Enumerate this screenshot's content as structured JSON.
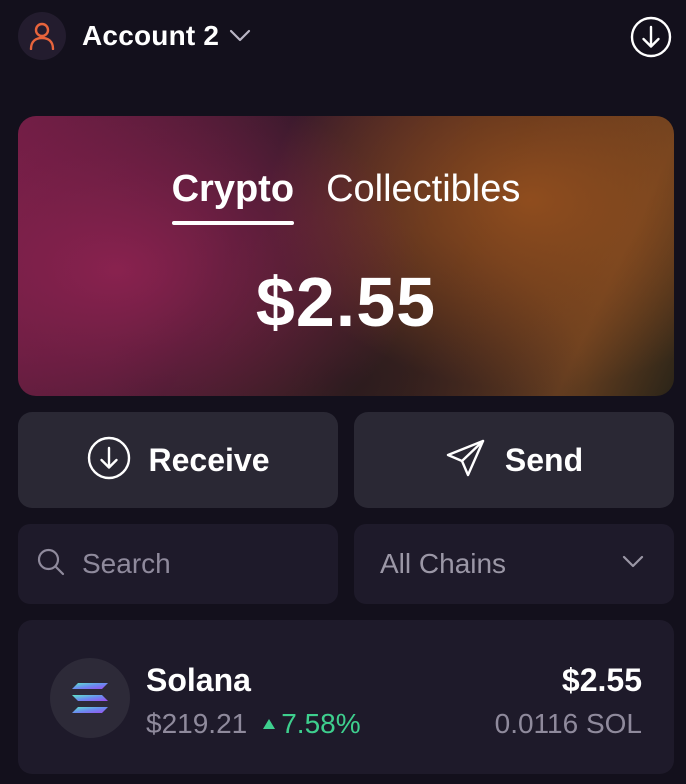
{
  "header": {
    "account_name": "Account 2",
    "avatar_icon": "person-icon",
    "chevron_icon": "chevron-down-icon",
    "download_icon": "arrow-down-circle-icon"
  },
  "balance_card": {
    "tabs": [
      {
        "label": "Crypto",
        "active": true
      },
      {
        "label": "Collectibles",
        "active": false
      }
    ],
    "total_balance": "$2.55"
  },
  "actions": {
    "receive_label": "Receive",
    "receive_icon": "arrow-down-circle-icon",
    "send_label": "Send",
    "send_icon": "paper-plane-icon"
  },
  "filters": {
    "search_placeholder": "Search",
    "search_value": "",
    "search_icon": "search-icon",
    "chain_selected": "All Chains",
    "chain_icon": "chevron-down-icon"
  },
  "tokens": [
    {
      "name": "Solana",
      "icon": "solana-logo-icon",
      "price": "$219.21",
      "change": "7.58%",
      "change_direction": "up",
      "value": "$2.55",
      "quantity": "0.0116 SOL"
    }
  ],
  "colors": {
    "background": "#13101c",
    "button_bg": "#2a2834",
    "panel_bg": "#1e1a2a",
    "positive": "#3ecf8e",
    "muted_text": "#8f8a9c",
    "avatar_accent": "#e8643c"
  }
}
